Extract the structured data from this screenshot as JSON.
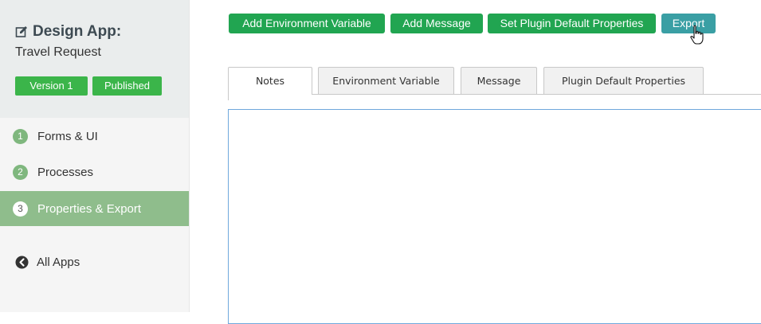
{
  "app": {
    "title": "Design App:",
    "name": "Travel Request",
    "version_label": "Version 1",
    "status_label": "Published"
  },
  "sidebar": {
    "items": [
      {
        "num": "1",
        "label": "Forms & UI"
      },
      {
        "num": "2",
        "label": "Processes"
      },
      {
        "num": "3",
        "label": "Properties & Export",
        "active": true
      }
    ],
    "all_apps_label": "All Apps"
  },
  "toolbar": {
    "add_env_label": "Add Environment Variable",
    "add_message_label": "Add Message",
    "set_plugin_label": "Set Plugin Default Properties",
    "export_label": "Export"
  },
  "tabs": [
    {
      "label": "Notes",
      "active": true
    },
    {
      "label": "Environment Variable"
    },
    {
      "label": "Message"
    },
    {
      "label": "Plugin Default Properties"
    }
  ],
  "colors": {
    "green": "#21a551",
    "teal": "#3a9fa4",
    "active_nav": "#8fbd8c",
    "panel_border": "#6fa8dc"
  },
  "icons": {
    "edit": "edit-icon",
    "back": "arrow-left-circle-icon",
    "cursor": "hand-pointer-icon"
  }
}
